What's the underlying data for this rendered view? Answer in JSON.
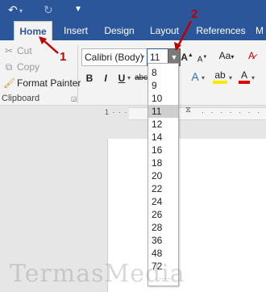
{
  "titlebar": {
    "undo_icon": "undo-icon",
    "redo_icon": "redo-icon",
    "customize_icon": "customize-quick-access-icon"
  },
  "tabs": [
    {
      "label": "Home",
      "active": true
    },
    {
      "label": "Insert"
    },
    {
      "label": "Design"
    },
    {
      "label": "Layout"
    },
    {
      "label": "References"
    },
    {
      "label": "M"
    }
  ],
  "clipboard": {
    "cut": "Cut",
    "copy": "Copy",
    "format_painter": "Format Painter",
    "group_label": "Clipboard"
  },
  "font": {
    "name": "Calibri (Body)",
    "size": "11",
    "bold": "B",
    "italic": "I",
    "underline": "U",
    "strikethrough": "abc",
    "grow": "A",
    "shrink": "A",
    "change_case": "Aa",
    "text_effects": "A",
    "highlight": "ab",
    "font_color": "A"
  },
  "font_sizes": [
    "8",
    "9",
    "10",
    "11",
    "12",
    "14",
    "16",
    "18",
    "20",
    "22",
    "24",
    "26",
    "28",
    "36",
    "48",
    "72"
  ],
  "selected_size": "11",
  "annotations": {
    "label1": "1",
    "label2": "2"
  },
  "watermark": "TermasMedia",
  "colors": {
    "ribbon_blue": "#2b579a",
    "annotation_red": "#c00000"
  }
}
